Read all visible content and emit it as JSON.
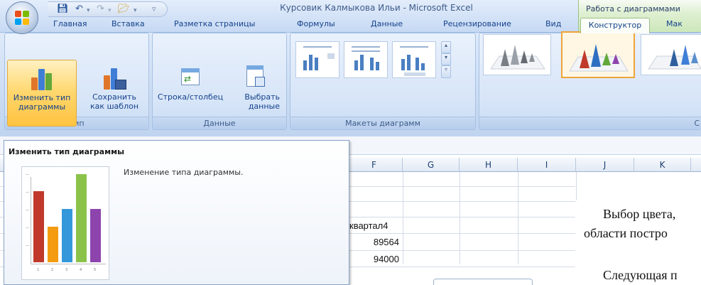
{
  "window": {
    "title": "Курсовик Калмыкова Ильи - Microsoft Excel",
    "context_tab_header": "Работа с диаграммами"
  },
  "tabs": [
    {
      "label": "Главная"
    },
    {
      "label": "Вставка"
    },
    {
      "label": "Разметка страницы"
    },
    {
      "label": "Формулы"
    },
    {
      "label": "Данные"
    },
    {
      "label": "Рецензирование"
    },
    {
      "label": "Вид"
    },
    {
      "label": "Конструктор"
    },
    {
      "label": "Мак"
    }
  ],
  "ribbon": {
    "groups": {
      "type": "Тип",
      "data": "Данные",
      "layouts": "Макеты диаграмм",
      "styles": "С"
    },
    "buttons": {
      "change_type_1": "Изменить тип",
      "change_type_2": "диаграммы",
      "save_template_1": "Сохранить",
      "save_template_2": "как шаблон",
      "row_col": "Строка/столбец",
      "select_data_1": "Выбрать",
      "select_data_2": "данные"
    }
  },
  "sheet": {
    "columns": [
      "F",
      "G",
      "H",
      "I",
      "J",
      "K"
    ],
    "cells": {
      "quarter_header": "квартал4",
      "val1": "89564",
      "val2": "94000"
    }
  },
  "tooltip": {
    "title": "Изменить тип диаграммы",
    "description": "Изменение типа диаграммы.",
    "preview_ticks": [
      "1",
      "2",
      "3",
      "4",
      "5"
    ]
  },
  "document": {
    "line1": "Выбор цвета,",
    "line2": "области постро",
    "line3": "Следующая п"
  },
  "colors": {
    "active_button": "#ffd66b",
    "context_tab": "#cde7bb",
    "bar_red": "#c0392b",
    "bar_orange": "#f39c12",
    "bar_blue": "#3498db",
    "bar_green": "#8bc34a",
    "bar_purple": "#8e44ad"
  }
}
